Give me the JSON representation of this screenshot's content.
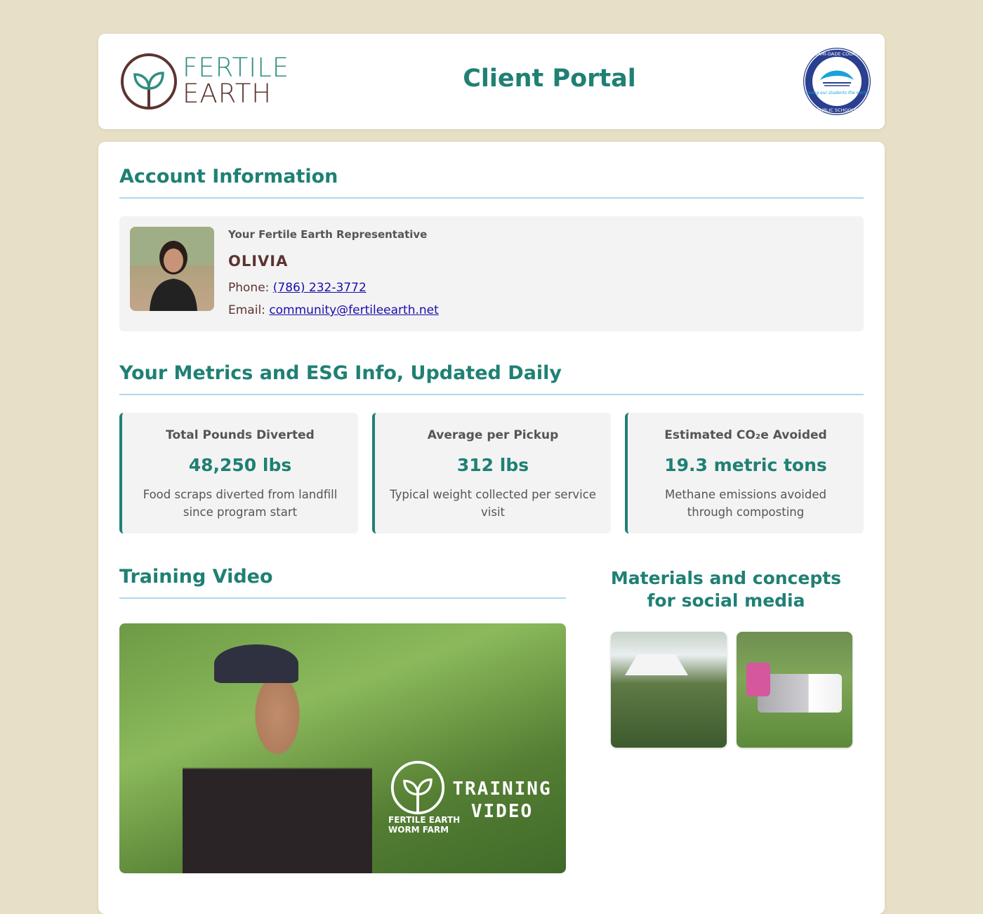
{
  "header": {
    "brand_line1": "FERTILE",
    "brand_line2": "EARTH",
    "title": "Client Portal",
    "seal_top_text": "MIAMI-DADE COUNTY",
    "seal_bottom_text": "PUBLIC SCHOOLS",
    "seal_motto": "giving our students the world"
  },
  "account": {
    "heading": "Account Information",
    "rep_label": "Your Fertile Earth Representative",
    "rep_name": "OLIVIA",
    "phone_label": "Phone:",
    "phone": "(786) 232-3772",
    "email_label": "Email:",
    "email": "community@fertileearth.net"
  },
  "metrics": {
    "heading": "Your Metrics and ESG Info, Updated Daily",
    "cards": [
      {
        "label": "Total Pounds Diverted",
        "value": "48,250 lbs",
        "desc": "Food scraps diverted from landfill since program start"
      },
      {
        "label": "Average per Pickup",
        "value": "312 lbs",
        "desc": "Typical weight collected per service visit"
      },
      {
        "label": "Estimated CO₂e Avoided",
        "value": "19.3 metric tons",
        "desc": "Methane emissions avoided through composting"
      }
    ]
  },
  "training": {
    "heading": "Training Video",
    "overlay_line1": "TRAINING",
    "overlay_line2": "VIDEO",
    "overlay_brand1": "FERTILE EARTH",
    "overlay_brand2": "WORM FARM"
  },
  "social": {
    "heading": "Materials and concepts for social media"
  },
  "colors": {
    "accent": "#1f8074",
    "brand_brown": "#5c3430",
    "background": "#e7dfc6",
    "divider": "#aed7ec"
  }
}
